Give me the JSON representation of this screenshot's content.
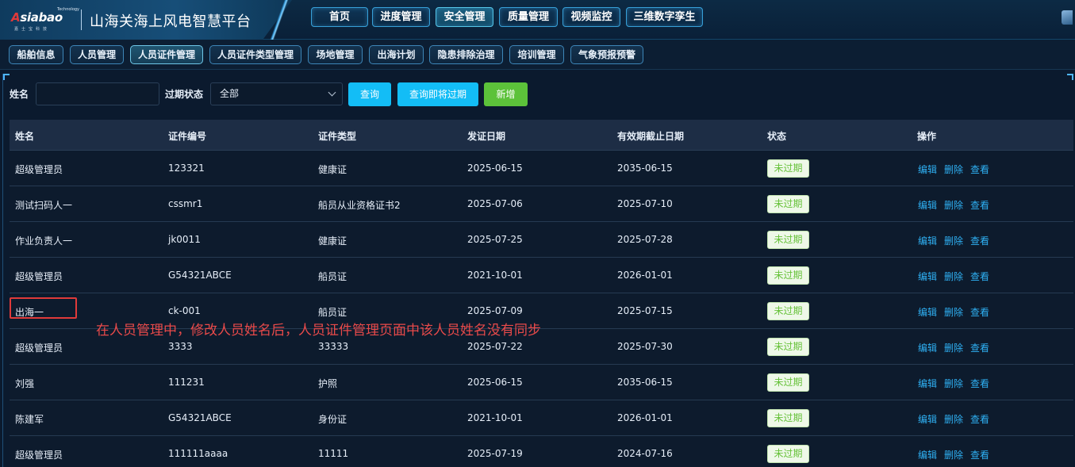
{
  "header": {
    "logo_tech": "Technology",
    "logo_main_a": "A",
    "logo_main_rest": "siabao",
    "logo_sub": "嘉士宝科技",
    "app_title": "山海关海上风电智慧平台",
    "nav": [
      {
        "label": "首页"
      },
      {
        "label": "进度管理"
      },
      {
        "label": "安全管理",
        "active": true
      },
      {
        "label": "质量管理"
      },
      {
        "label": "视频监控"
      },
      {
        "label": "三维数字孪生"
      }
    ]
  },
  "subnav": [
    {
      "label": "船舶信息"
    },
    {
      "label": "人员管理"
    },
    {
      "label": "人员证件管理",
      "active": true
    },
    {
      "label": "人员证件类型管理"
    },
    {
      "label": "场地管理"
    },
    {
      "label": "出海计划"
    },
    {
      "label": "隐患排除治理"
    },
    {
      "label": "培训管理"
    },
    {
      "label": "气象预报预警"
    }
  ],
  "filters": {
    "name_label": "姓名",
    "name_value": "",
    "status_label": "过期状态",
    "status_value": "全部",
    "query_button": "查询",
    "query_expiring_button": "查询即将过期",
    "add_button": "新增"
  },
  "table": {
    "columns": [
      "姓名",
      "证件编号",
      "证件类型",
      "发证日期",
      "有效期截止日期",
      "状态",
      "操作"
    ],
    "rows": [
      {
        "name": "超级管理员",
        "cert_no": "123321",
        "cert_type": "健康证",
        "issue_date": "2025-06-15",
        "expire_date": "2035-06-15",
        "status": "未过期"
      },
      {
        "name": "测试扫码人一",
        "cert_no": "cssmr1",
        "cert_type": "船员从业资格证书2",
        "issue_date": "2025-07-06",
        "expire_date": "2025-07-10",
        "status": "未过期"
      },
      {
        "name": "作业负责人一",
        "cert_no": "jk0011",
        "cert_type": "健康证",
        "issue_date": "2025-07-25",
        "expire_date": "2025-07-28",
        "status": "未过期"
      },
      {
        "name": "超级管理员",
        "cert_no": "G54321ABCE",
        "cert_type": "船员证",
        "issue_date": "2021-10-01",
        "expire_date": "2026-01-01",
        "status": "未过期"
      },
      {
        "name": "出海一",
        "cert_no": "ck-001",
        "cert_type": "船员证",
        "issue_date": "2025-07-09",
        "expire_date": "2025-07-15",
        "status": "未过期"
      },
      {
        "name": "超级管理员",
        "cert_no": "3333",
        "cert_type": "33333",
        "issue_date": "2025-07-22",
        "expire_date": "2025-07-30",
        "status": "未过期"
      },
      {
        "name": "刘强",
        "cert_no": "111231",
        "cert_type": "护照",
        "issue_date": "2025-06-15",
        "expire_date": "2035-06-15",
        "status": "未过期"
      },
      {
        "name": "陈建军",
        "cert_no": "G54321ABCE",
        "cert_type": "身份证",
        "issue_date": "2021-10-01",
        "expire_date": "2026-01-01",
        "status": "未过期"
      },
      {
        "name": "超级管理员",
        "cert_no": "111111aaaa",
        "cert_type": "11111",
        "issue_date": "2025-07-19",
        "expire_date": "2024-07-16",
        "status": "未过期"
      }
    ],
    "actions": {
      "edit": "编辑",
      "delete": "删除",
      "view": "查看"
    }
  },
  "annotation": "在人员管理中，修改人员姓名后，人员证件管理页面中该人员姓名没有同步",
  "colors": {
    "accent": "#13bdf6",
    "add_green": "#5cc23a",
    "status_green": "#67c23a",
    "link_blue": "#2fb0f3",
    "annotation_red": "#e84a4a"
  }
}
